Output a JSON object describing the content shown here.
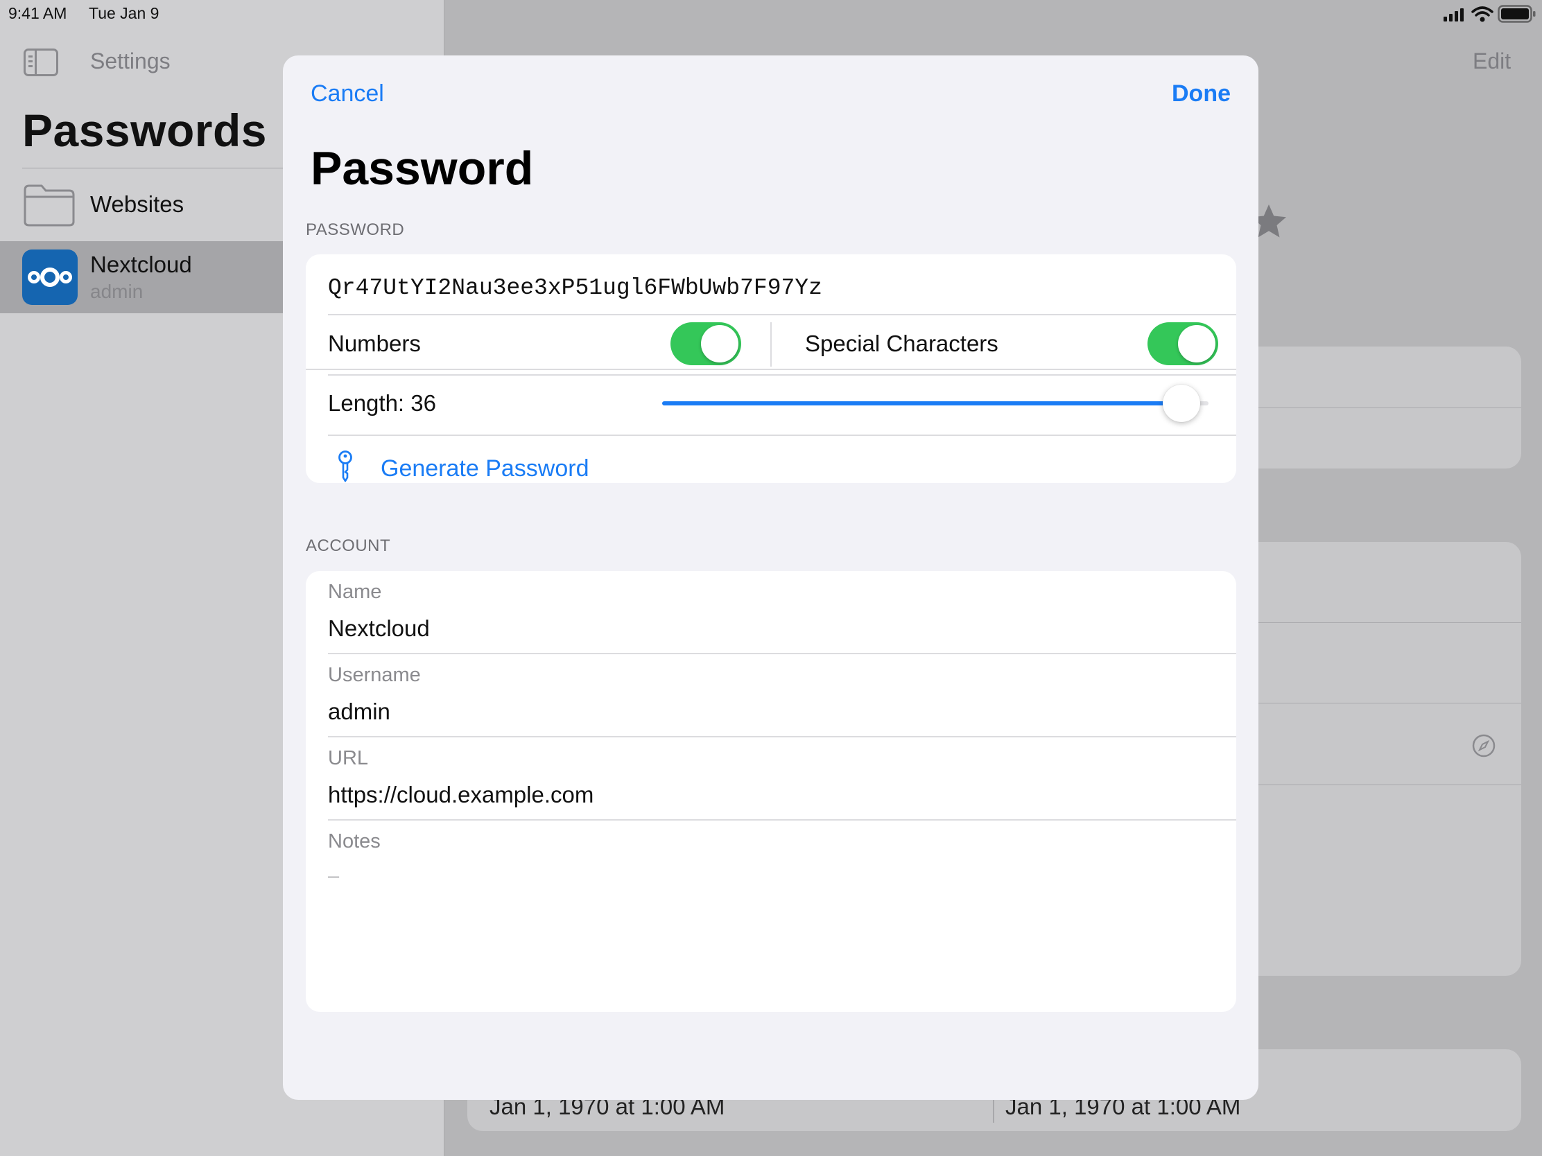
{
  "status_bar": {
    "time": "9:41 AM",
    "date": "Tue Jan 9"
  },
  "sidebar": {
    "back_label": "Settings",
    "title": "Passwords",
    "items": [
      {
        "label": "Websites",
        "icon": "folder-icon"
      },
      {
        "label": "Nextcloud",
        "subtitle": "admin",
        "icon": "nextcloud-logo-icon"
      }
    ]
  },
  "detail": {
    "edit_label": "Edit",
    "created_date": "Jan 1, 1970 at 1:00 AM",
    "modified_date": "Jan 1, 1970 at 1:00 AM"
  },
  "sheet": {
    "cancel_label": "Cancel",
    "done_label": "Done",
    "title": "Password",
    "password_section": {
      "header": "PASSWORD",
      "value": "Qr47UtYI2Nau3ee3xP51ugl6FWbUwb7F97Yz",
      "numbers_label": "Numbers",
      "numbers_enabled": true,
      "special_label": "Special Characters",
      "special_enabled": true,
      "length_label": "Length: 36",
      "length_slider_fraction": 0.95,
      "generate_label": "Generate Password"
    },
    "account_section": {
      "header": "ACCOUNT",
      "name_label": "Name",
      "name_value": "Nextcloud",
      "username_label": "Username",
      "username_value": "admin",
      "url_label": "URL",
      "url_value": "https://cloud.example.com",
      "notes_label": "Notes",
      "notes_value": "–"
    }
  },
  "colors": {
    "accent": "#1a7cf5",
    "toggle_on": "#34c759",
    "nextcloud_brand": "#1565b0"
  }
}
